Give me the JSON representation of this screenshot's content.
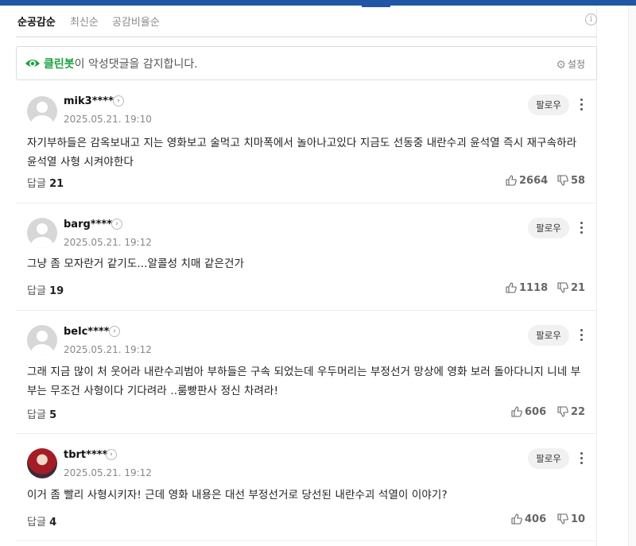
{
  "sort": {
    "tabs": [
      {
        "label": "순공감순"
      },
      {
        "label": "최신순"
      },
      {
        "label": "공감비율순"
      }
    ]
  },
  "cleanbot": {
    "brand": "클린봇",
    "message": "이 악성댓글을 감지합니다.",
    "settings_label": "설정"
  },
  "follow_label": "팔로우",
  "reply_label": "답글",
  "comments": [
    {
      "username": "mik3****",
      "timestamp": "2025.05.21. 19:10",
      "text": "자기부하들은 감옥보내고 지는 영화보고 술먹고 치마폭에서 놀아나고있다 지금도 선동중 내란수괴 윤석열 즉시 재구속하라 윤석열 사형 시켜야한다",
      "replies": "21",
      "likes": "2664",
      "dislikes": "58",
      "avatar": "default"
    },
    {
      "username": "barg****",
      "timestamp": "2025.05.21. 19:12",
      "text": "그냥 좀 모자란거 같기도...알콜성 치매 같은건가",
      "replies": "19",
      "likes": "1118",
      "dislikes": "21",
      "avatar": "default"
    },
    {
      "username": "belc****",
      "timestamp": "2025.05.21. 19:12",
      "text": "그래 지금 많이 처 웃어라 내란수괴범아 부하들은 구속 되었는데 우두머리는 부정선거 망상에 영화 보러 돌아다니지 니네 부부는 무조건 사형이다 기다려라 ..룸빵판사 정신 차려라!",
      "replies": "5",
      "likes": "606",
      "dislikes": "22",
      "avatar": "default"
    },
    {
      "username": "tbrt****",
      "timestamp": "2025.05.21. 19:12",
      "text": "이거 좀 빨리 사형시키자! 근데 영화 내용은 대선 부정선거로 당선된 내란수괴 석열이 이야기?",
      "replies": "4",
      "likes": "406",
      "dislikes": "10",
      "avatar": "photo"
    }
  ],
  "colors": {
    "top_bar": "#1f57a4",
    "cleanbot_green": "#1aa33b"
  },
  "icons": {
    "cleanbot": "cleanbot-eye-icon",
    "settings": "gear-icon",
    "info": "info-icon",
    "like": "thumbs-up-icon",
    "dislike": "thumbs-down-icon",
    "more": "more-vertical-icon",
    "profile_link": "chevron-right-icon"
  }
}
